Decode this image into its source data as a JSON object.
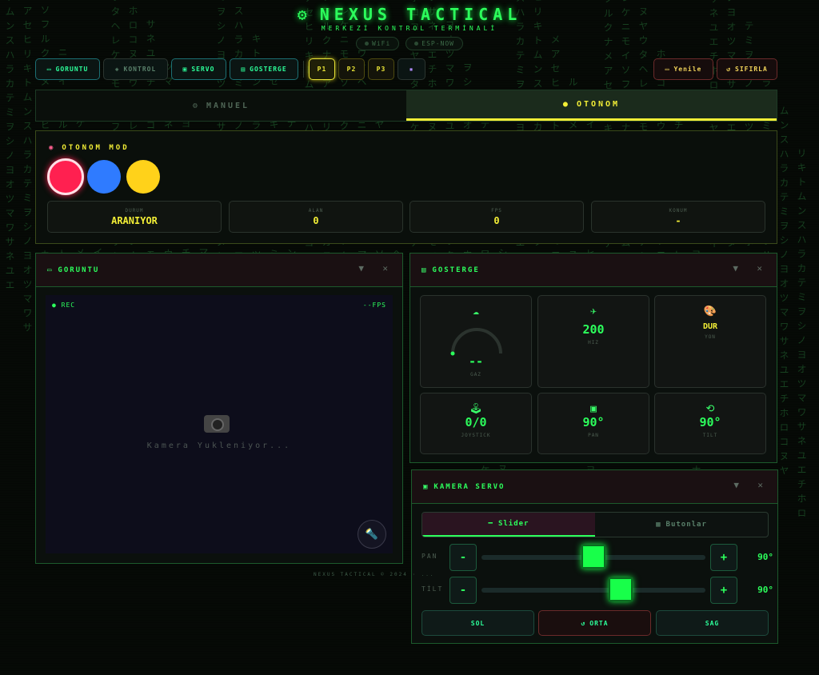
{
  "header": {
    "title": "NEXUS TACTICAL",
    "subtitle": "MERKEZİ KONTROL TERMİNALİ",
    "status": [
      {
        "label": "WiFi"
      },
      {
        "label": "ESP-NOW"
      }
    ]
  },
  "toolbar": {
    "views": [
      {
        "label": "GORUNTU",
        "icon": "monitor-icon",
        "glyph": "▭"
      },
      {
        "label": "KONTROL",
        "icon": "gamepad-icon",
        "glyph": "◈"
      },
      {
        "label": "SERVO",
        "icon": "camera-icon",
        "glyph": "▣"
      },
      {
        "label": "GOSTERGE",
        "icon": "chart-icon",
        "glyph": "▤"
      }
    ],
    "presets": [
      "P1",
      "P2",
      "P3"
    ],
    "save_glyph": "▪",
    "refresh_label": "Yenile",
    "refresh_glyph": "▭",
    "reset_label": "SIFIRLA",
    "reset_glyph": "↺"
  },
  "modes": {
    "manual": "MANUEL",
    "manual_glyph": "⚙",
    "auto": "OTONOM",
    "auto_glyph": "●"
  },
  "otonom": {
    "title": "OTONOM MOD",
    "title_glyph": "◉",
    "colors": [
      "#ff2050",
      "#2f7bff",
      "#ffd21a"
    ],
    "stats": [
      {
        "label": "DURUM",
        "value": "ARANIYOR"
      },
      {
        "label": "ALAN",
        "value": "0"
      },
      {
        "label": "FPS",
        "value": "0"
      },
      {
        "label": "KONUM",
        "value": "-"
      }
    ]
  },
  "goruntu": {
    "title": "GORUNTU",
    "rec": "● REC",
    "fps": "--FPS",
    "loading": "Kamera Yukleniyor...",
    "collapse_glyph": "▼",
    "close_glyph": "✕",
    "flash_glyph": "🔦"
  },
  "gosterge": {
    "title": "GOSTERGE",
    "cells": [
      {
        "label": "GAZ",
        "value": "--",
        "icon": "cloud-icon",
        "glyph": "☁"
      },
      {
        "label": "HIZ",
        "value": "200",
        "icon": "speed-icon",
        "glyph": "✈"
      },
      {
        "label": "YON",
        "value": "DUR",
        "icon": "palette-icon",
        "glyph": "🎨"
      },
      {
        "label": "JOYSTICK",
        "value": "0/0",
        "icon": "joystick-icon",
        "glyph": "🕹"
      },
      {
        "label": "PAN",
        "value": "90°",
        "icon": "camera-icon",
        "glyph": "▣"
      },
      {
        "label": "TILT",
        "value": "90°",
        "icon": "rotate-icon",
        "glyph": "⟲"
      }
    ],
    "gaz_level": 0
  },
  "servo": {
    "title": "KAMERA SERVO",
    "tab_slider": "Slider",
    "tab_buttons": "Butonlar",
    "pan": {
      "label": "PAN",
      "value": "90°",
      "level": 0.5,
      "minus": "-",
      "plus": "+"
    },
    "tilt": {
      "label": "TİLT",
      "value": "90°",
      "level": 0.62,
      "minus": "-",
      "plus": "+"
    },
    "left": "SOL",
    "center": "ORTA",
    "right": "SAG"
  },
  "footer": "NEXUS TACTICAL © 2024 · ..."
}
